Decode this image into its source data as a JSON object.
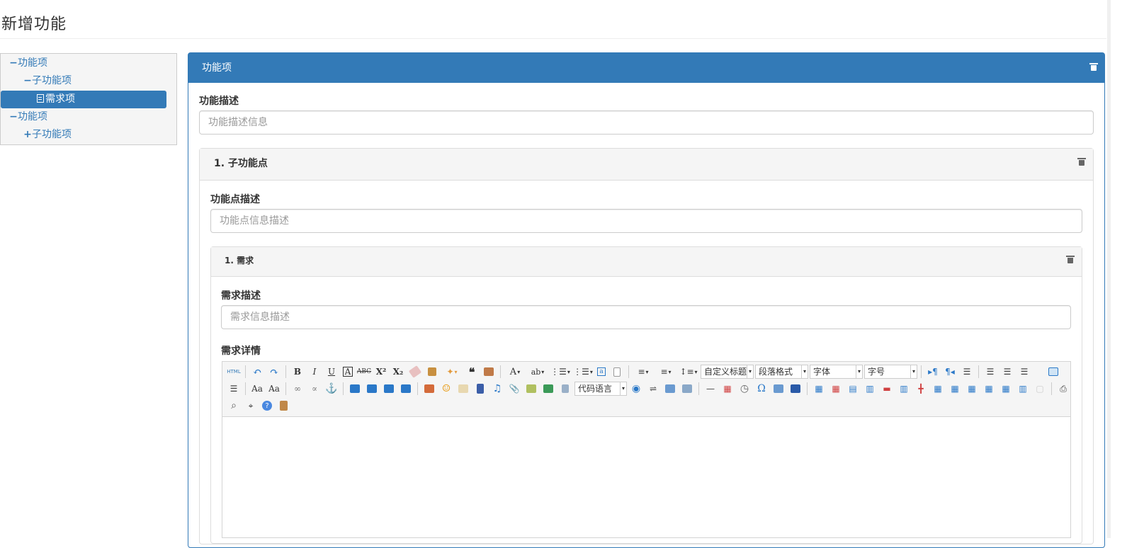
{
  "page": {
    "title": "新增功能"
  },
  "tree": [
    {
      "label": "功能项",
      "icon": "minus-icon",
      "level": 0,
      "active": false
    },
    {
      "label": "子功能项",
      "icon": "minus-icon",
      "level": 1,
      "active": false
    },
    {
      "label": "需求项",
      "icon": "file-icon",
      "level": 2,
      "active": true
    },
    {
      "label": "功能项",
      "icon": "minus-icon",
      "level": 0,
      "active": false
    },
    {
      "label": "子功能项",
      "icon": "plus-icon",
      "level": 1,
      "active": false
    }
  ],
  "panel": {
    "title": "功能项",
    "desc_label": "功能描述",
    "desc_placeholder": "功能描述信息",
    "sub": {
      "title": "1. 子功能点",
      "desc_label": "功能点描述",
      "desc_placeholder": "功能点信息描述",
      "req": {
        "title": "1. 需求",
        "desc_label": "需求描述",
        "desc_placeholder": "需求信息描述",
        "detail_label": "需求详情"
      }
    }
  },
  "editor": {
    "html_label": "HTML",
    "custom_title": "自定义标题",
    "paragraph": "段落格式",
    "font": "字体",
    "font_size": "字号",
    "code_lang": "代码语言"
  },
  "colors": {
    "primary": "#337ab7",
    "heading_bg": "#f5f5f5"
  }
}
